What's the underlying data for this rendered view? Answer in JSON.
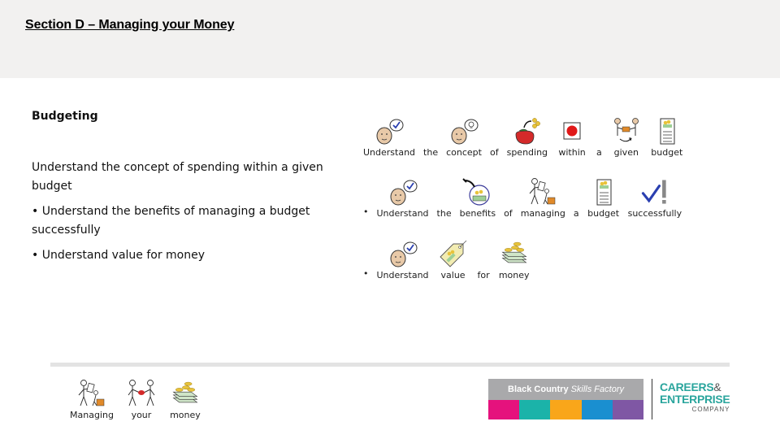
{
  "header": {
    "title": "Section D – Managing your Money",
    "background": "#f2f1f0"
  },
  "left": {
    "heading": "Budgeting",
    "items": [
      "Understand the concept of spending within a given budget",
      "• Understand the benefits of managing a budget successfully",
      "• Understand value for money"
    ]
  },
  "symbol_rows": [
    {
      "bullet": "",
      "words": [
        {
          "word": "Understand",
          "icon": "thinking-face-check-icon"
        },
        {
          "word": "the",
          "icon": ""
        },
        {
          "word": "concept",
          "icon": "thinking-face-lightbulb-icon"
        },
        {
          "word": "of",
          "icon": ""
        },
        {
          "word": "spending",
          "icon": "purse-coins-icon"
        },
        {
          "word": "within",
          "icon": "red-dot-in-box-icon"
        },
        {
          "word": "a",
          "icon": ""
        },
        {
          "word": "given",
          "icon": "two-people-exchange-icon"
        },
        {
          "word": "budget",
          "icon": "budget-list-icon"
        }
      ]
    },
    {
      "bullet": "•",
      "words": [
        {
          "word": "Understand",
          "icon": "thinking-face-check-icon"
        },
        {
          "word": "the",
          "icon": ""
        },
        {
          "word": "benefits",
          "icon": "money-circle-arrow-icon"
        },
        {
          "word": "of",
          "icon": ""
        },
        {
          "word": "managing",
          "icon": "person-managing-icon"
        },
        {
          "word": "a",
          "icon": ""
        },
        {
          "word": "budget",
          "icon": "budget-list-icon"
        },
        {
          "word": "successfully",
          "icon": "check-exclamation-icon"
        }
      ]
    },
    {
      "bullet": "•",
      "words": [
        {
          "word": "Understand",
          "icon": "thinking-face-check-icon"
        },
        {
          "word": "value",
          "icon": "price-tag-money-icon"
        },
        {
          "word": "for",
          "icon": ""
        },
        {
          "word": "money",
          "icon": "money-stack-coins-icon"
        }
      ]
    }
  ],
  "footer_symbols": [
    {
      "word": "Managing",
      "icon": "person-managing-icon"
    },
    {
      "word": "your",
      "icon": "two-people-passing-icon"
    },
    {
      "word": "money",
      "icon": "money-stack-coins-icon"
    }
  ],
  "logos": {
    "bcsf": {
      "text_bold": "Black Country",
      "text_italic": "Skills Factory",
      "stripes": [
        "#e5127d",
        "#1bb3a9",
        "#f9a61a",
        "#1a8fd0",
        "#7f57a4"
      ],
      "top_color": "#a9a9ab"
    },
    "cec": {
      "line1": "CAREERS",
      "amp": "&",
      "line2": "ENTERPRISE",
      "line3": "COMPANY",
      "color": "#2aa59d"
    }
  }
}
